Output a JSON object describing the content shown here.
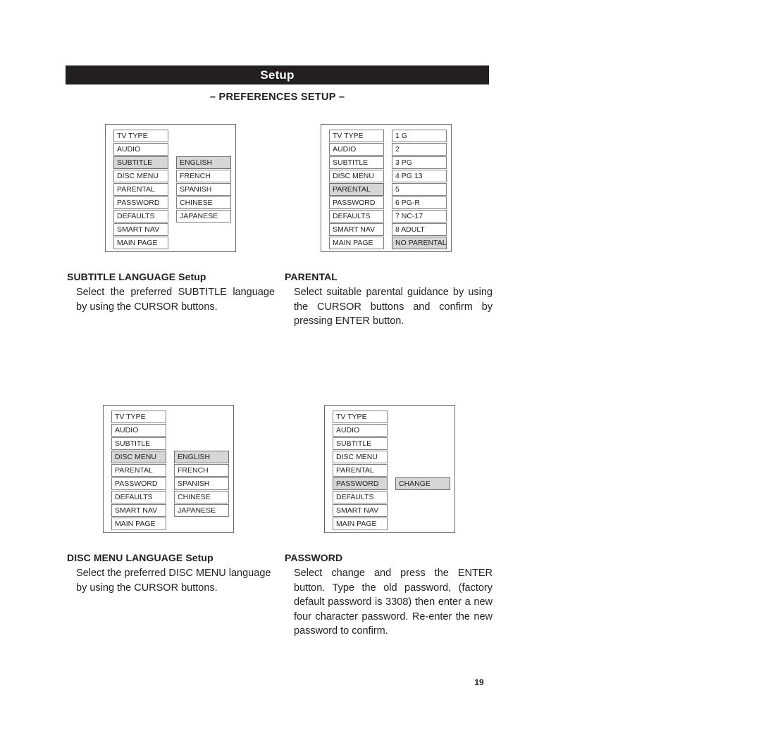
{
  "header": {
    "title": "Setup",
    "section_title": "– PREFERENCES SETUP –"
  },
  "menus": {
    "subtitle_language": {
      "name": "subtitle-language-menu",
      "left_items": [
        "TV TYPE",
        "AUDIO",
        "SUBTITLE",
        "DISC MENU",
        "PARENTAL",
        "PASSWORD",
        "DEFAULTS",
        "SMART NAV",
        "MAIN PAGE"
      ],
      "left_selected_index": 2,
      "right_items": [
        "ENGLISH",
        "FRENCH",
        "SPANISH",
        "CHINESE",
        "JAPANESE"
      ],
      "right_selected_index": 0,
      "right_offset_rows": 2
    },
    "parental": {
      "name": "parental-menu",
      "left_items": [
        "TV TYPE",
        "AUDIO",
        "SUBTITLE",
        "DISC MENU",
        "PARENTAL",
        "PASSWORD",
        "DEFAULTS",
        "SMART NAV",
        "MAIN PAGE"
      ],
      "left_selected_index": 4,
      "right_items": [
        "1 G",
        "2",
        "3 PG",
        "4 PG 13",
        "5",
        "6 PG-R",
        "7 NC-17",
        "8 ADULT",
        "NO PARENTAL"
      ],
      "right_selected_index": 8,
      "right_offset_rows": 0
    },
    "disc_menu_language": {
      "name": "disc-menu-language-menu",
      "left_items": [
        "TV TYPE",
        "AUDIO",
        "SUBTITLE",
        "DISC MENU",
        "PARENTAL",
        "PASSWORD",
        "DEFAULTS",
        "SMART NAV",
        "MAIN PAGE"
      ],
      "left_selected_index": 3,
      "right_items": [
        "ENGLISH",
        "FRENCH",
        "SPANISH",
        "CHINESE",
        "JAPANESE"
      ],
      "right_selected_index": 0,
      "right_offset_rows": 3
    },
    "password": {
      "name": "password-menu",
      "left_items": [
        "TV TYPE",
        "AUDIO",
        "SUBTITLE",
        "DISC MENU",
        "PARENTAL",
        "PASSWORD",
        "DEFAULTS",
        "SMART NAV",
        "MAIN PAGE"
      ],
      "left_selected_index": 5,
      "right_items": [
        "CHANGE"
      ],
      "right_selected_index": 0,
      "right_offset_rows": 5
    }
  },
  "sections": {
    "subtitle_language": {
      "heading": "SUBTITLE LANGUAGE Setup",
      "body": "Select the preferred SUBTITLE language by using the CURSOR buttons."
    },
    "parental": {
      "heading": "PARENTAL",
      "body": "Select suitable parental guidance by using the CURSOR buttons and confirm by pressing ENTER button."
    },
    "disc_menu_language": {
      "heading": "DISC MENU LANGUAGE Setup",
      "body": "Select the preferred DISC MENU language by using the CURSOR buttons."
    },
    "password": {
      "heading": "PASSWORD",
      "body": "Select change and press the ENTER button. Type the old password, (factory default password is 3308) then enter a new four character password. Re-enter the new password to confirm."
    }
  },
  "footer": {
    "page_number": "19"
  },
  "colors": {
    "header_bg": "#231f20",
    "header_text": "#ffffff",
    "selected_cell_bg": "#d6d6d6",
    "cell_border": "#808080",
    "panel_border": "#6d6a6b",
    "body_text": "#231f20"
  }
}
